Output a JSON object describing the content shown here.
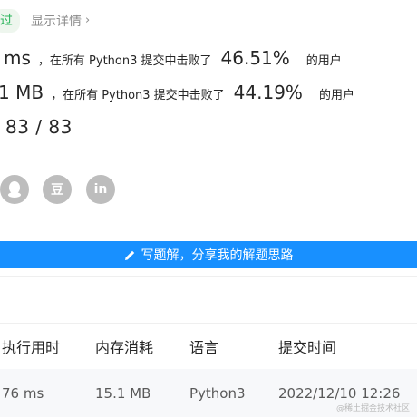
{
  "status": {
    "badge": "过",
    "details_link": "显示详情",
    "chevron": "›"
  },
  "runtime": {
    "value": "ms",
    "text": "，在所有 Python3 提交中击败了",
    "percent": "46.51%",
    "suffix": "的用户"
  },
  "memory": {
    "value": "1 MB",
    "text": "，在所有 Python3 提交中击败了",
    "percent": "44.19%",
    "suffix": "的用户"
  },
  "testcases": {
    "text": "83 / 83"
  },
  "share": {
    "qq_glyph": "",
    "douban_glyph": "豆",
    "linkedin_glyph": "in"
  },
  "write_bar": {
    "label": "写题解，分享我的解题思路",
    "icon": "pencil-icon",
    "color": "#1890ff"
  },
  "table": {
    "headers": [
      "执行用时",
      "内存消耗",
      "语言",
      "提交时间"
    ],
    "rows": [
      [
        "76 ms",
        "15.1 MB",
        "Python3",
        "2022/12/10 12:26"
      ]
    ]
  },
  "watermark": "@稀土掘金技术社区",
  "colors": {
    "accent": "#1890ff",
    "success": "#2db55d",
    "icon_gray": "#bdbdbd"
  }
}
